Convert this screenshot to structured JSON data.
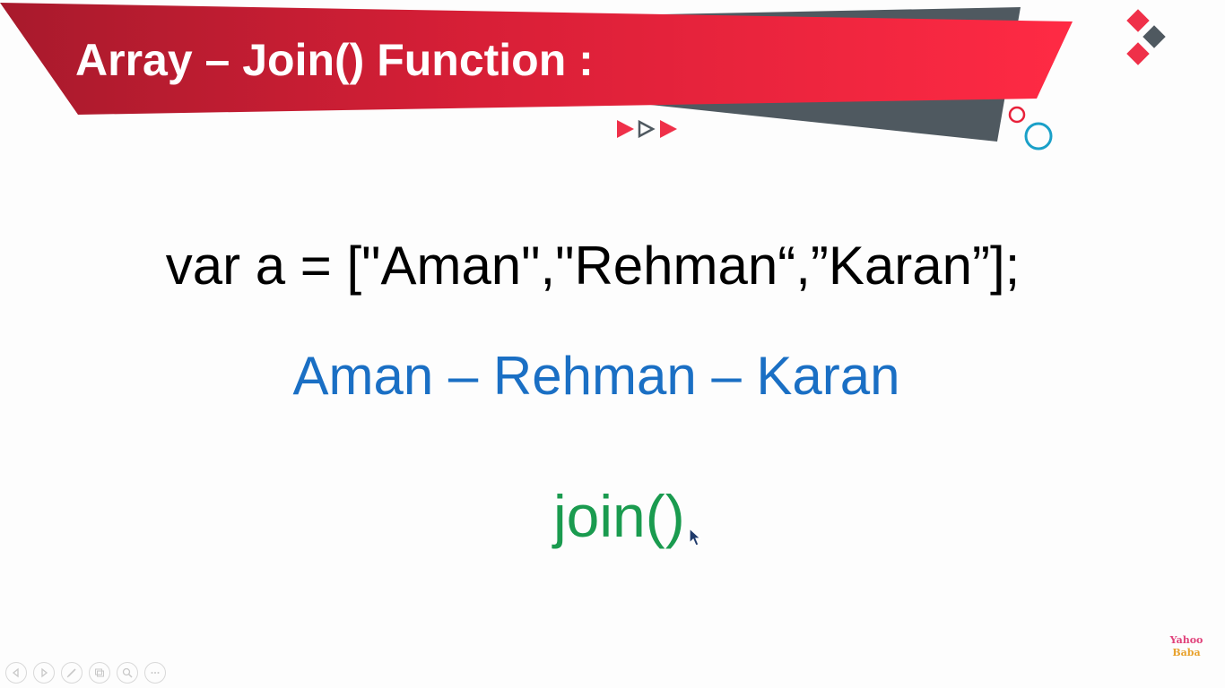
{
  "slide": {
    "title": "Array – Join() Function :",
    "code_line": "var a = [\"Aman\",\"Rehman“,”Karan”];",
    "result_line": "Aman – Rehman – Karan",
    "join_text": "join()"
  },
  "brand": {
    "line1": "Yahoo",
    "line2": "Baba"
  },
  "presentation_controls": [
    {
      "name": "previous-slide",
      "icon": "chevron-left-icon"
    },
    {
      "name": "next-slide",
      "icon": "chevron-right-icon"
    },
    {
      "name": "pen-tool",
      "icon": "pen-icon"
    },
    {
      "name": "see-all-slides",
      "icon": "slides-grid-icon"
    },
    {
      "name": "zoom",
      "icon": "magnifier-icon"
    },
    {
      "name": "more-options",
      "icon": "ellipsis-icon"
    }
  ],
  "colors": {
    "banner_red": "#e8213a",
    "banner_dark_red": "#a81a2c",
    "banner_gray": "#4f5960",
    "code_text": "#000000",
    "result_blue": "#1a6fc4",
    "join_green": "#1a9b4f",
    "accent_teal": "#1aa0c8"
  }
}
